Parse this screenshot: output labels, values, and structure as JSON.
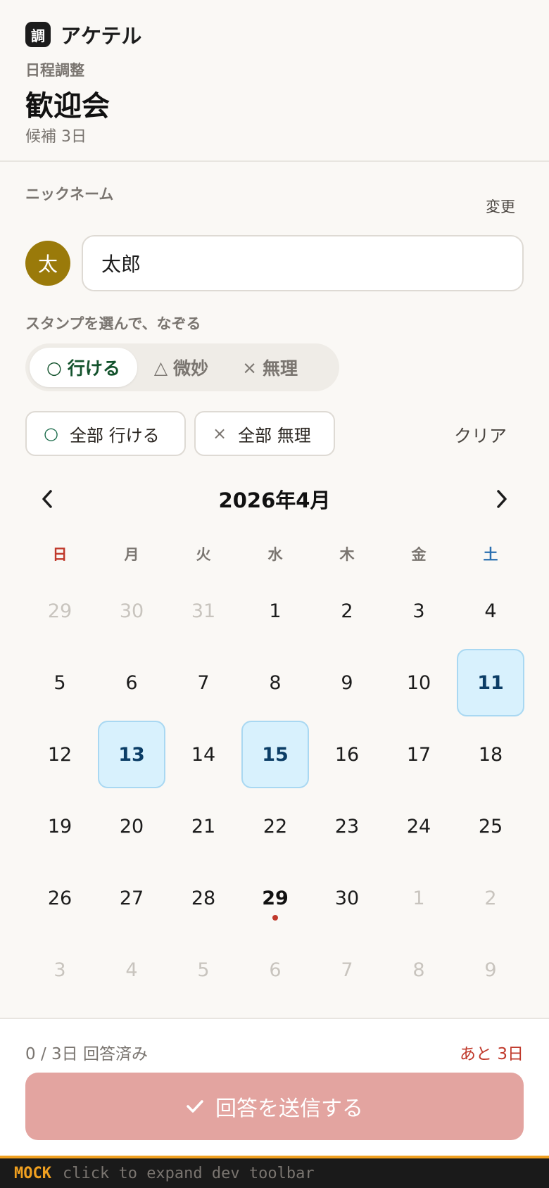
{
  "header": {
    "brand_mark": "調",
    "brand_name": "アケテル",
    "eyebrow": "日程調整",
    "title": "歓迎会",
    "subtitle": "候補 3日"
  },
  "nickname": {
    "label": "ニックネーム",
    "change_label": "変更",
    "avatar_initial": "太",
    "value": "太郎"
  },
  "stamps": {
    "label": "スタンプを選んで、なぞる",
    "options": [
      {
        "glyph": "○",
        "label": "行ける",
        "active": true
      },
      {
        "glyph": "△",
        "label": "微妙",
        "active": false
      },
      {
        "glyph": "×",
        "label": "無理",
        "active": false
      }
    ]
  },
  "bulk": {
    "all_ok_glyph": "○",
    "all_ok_label": "全部 行ける",
    "all_ng_glyph": "×",
    "all_ng_label": "全部 無理",
    "clear_label": "クリア"
  },
  "calendar": {
    "month_title": "2026年4月",
    "weekdays": [
      "日",
      "月",
      "火",
      "水",
      "木",
      "金",
      "土"
    ],
    "weeks": [
      [
        {
          "d": "29",
          "m": true
        },
        {
          "d": "30",
          "m": true
        },
        {
          "d": "31",
          "m": true
        },
        {
          "d": "1"
        },
        {
          "d": "2"
        },
        {
          "d": "3"
        },
        {
          "d": "4"
        }
      ],
      [
        {
          "d": "5"
        },
        {
          "d": "6"
        },
        {
          "d": "7"
        },
        {
          "d": "8"
        },
        {
          "d": "9"
        },
        {
          "d": "10"
        },
        {
          "d": "11",
          "s": true
        }
      ],
      [
        {
          "d": "12"
        },
        {
          "d": "13",
          "s": true
        },
        {
          "d": "14"
        },
        {
          "d": "15",
          "s": true
        },
        {
          "d": "16"
        },
        {
          "d": "17"
        },
        {
          "d": "18"
        }
      ],
      [
        {
          "d": "19"
        },
        {
          "d": "20"
        },
        {
          "d": "21"
        },
        {
          "d": "22"
        },
        {
          "d": "23"
        },
        {
          "d": "24"
        },
        {
          "d": "25"
        }
      ],
      [
        {
          "d": "26"
        },
        {
          "d": "27"
        },
        {
          "d": "28"
        },
        {
          "d": "29",
          "t": true
        },
        {
          "d": "30"
        },
        {
          "d": "1",
          "m": true
        },
        {
          "d": "2",
          "m": true
        }
      ],
      [
        {
          "d": "3",
          "m": true
        },
        {
          "d": "4",
          "m": true
        },
        {
          "d": "5",
          "m": true
        },
        {
          "d": "6",
          "m": true
        },
        {
          "d": "7",
          "m": true
        },
        {
          "d": "8",
          "m": true
        },
        {
          "d": "9",
          "m": true
        }
      ]
    ]
  },
  "footer": {
    "progress": "0 / 3日 回答済み",
    "remaining": "あと 3日",
    "submit_label": "回答を送信する"
  },
  "devbar": {
    "tag": "MOCK",
    "hint": "click to expand dev toolbar"
  },
  "colors": {
    "accent_green": "#14532d",
    "selected_day_bg": "#d8f1fd",
    "submit_disabled": "#e3a4a0",
    "sunday": "#c0392b",
    "saturday": "#2a6fb0"
  }
}
